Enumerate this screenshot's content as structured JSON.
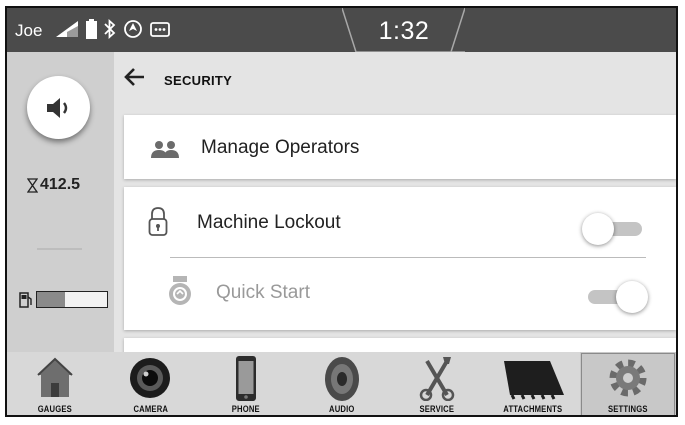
{
  "status_bar": {
    "user": "Joe",
    "time": "1:32",
    "icons": [
      "signal-icon",
      "battery-icon",
      "bluetooth-icon",
      "gps-icon",
      "message-icon"
    ]
  },
  "left_rail": {
    "volume_icon": "speaker-icon",
    "hours_icon": "hourglass-icon",
    "hours_value": "412.5",
    "fuel_icon": "fuel-pump-icon",
    "fuel_level": 0.4
  },
  "page": {
    "back_icon": "back-arrow-icon",
    "title": "SECURITY"
  },
  "settings": {
    "manage_operators": {
      "label": "Manage Operators",
      "icon": "operators-icon"
    },
    "machine_lockout": {
      "label": "Machine Lockout",
      "icon": "padlock-icon",
      "enabled": false
    },
    "quick_start": {
      "label": "Quick Start",
      "icon": "quick-start-icon",
      "enabled": true,
      "disabled": true
    }
  },
  "nav": {
    "items": [
      {
        "label": "GAUGES",
        "icon": "gauges-icon",
        "selected": false
      },
      {
        "label": "CAMERA",
        "icon": "camera-icon",
        "selected": false
      },
      {
        "label": "PHONE",
        "icon": "phone-icon",
        "selected": false
      },
      {
        "label": "AUDIO",
        "icon": "audio-icon",
        "selected": false
      },
      {
        "label": "SERVICE",
        "icon": "service-icon",
        "selected": false
      },
      {
        "label": "ATTACHMENTS",
        "icon": "attachments-icon",
        "selected": false
      },
      {
        "label": "SETTINGS",
        "icon": "settings-icon",
        "selected": true
      }
    ]
  },
  "colors": {
    "status_bar": "#4b4b4b",
    "rail": "#cfcfcf",
    "content_bg": "#e4e4e4",
    "nav_bg": "#d8d8d8"
  }
}
